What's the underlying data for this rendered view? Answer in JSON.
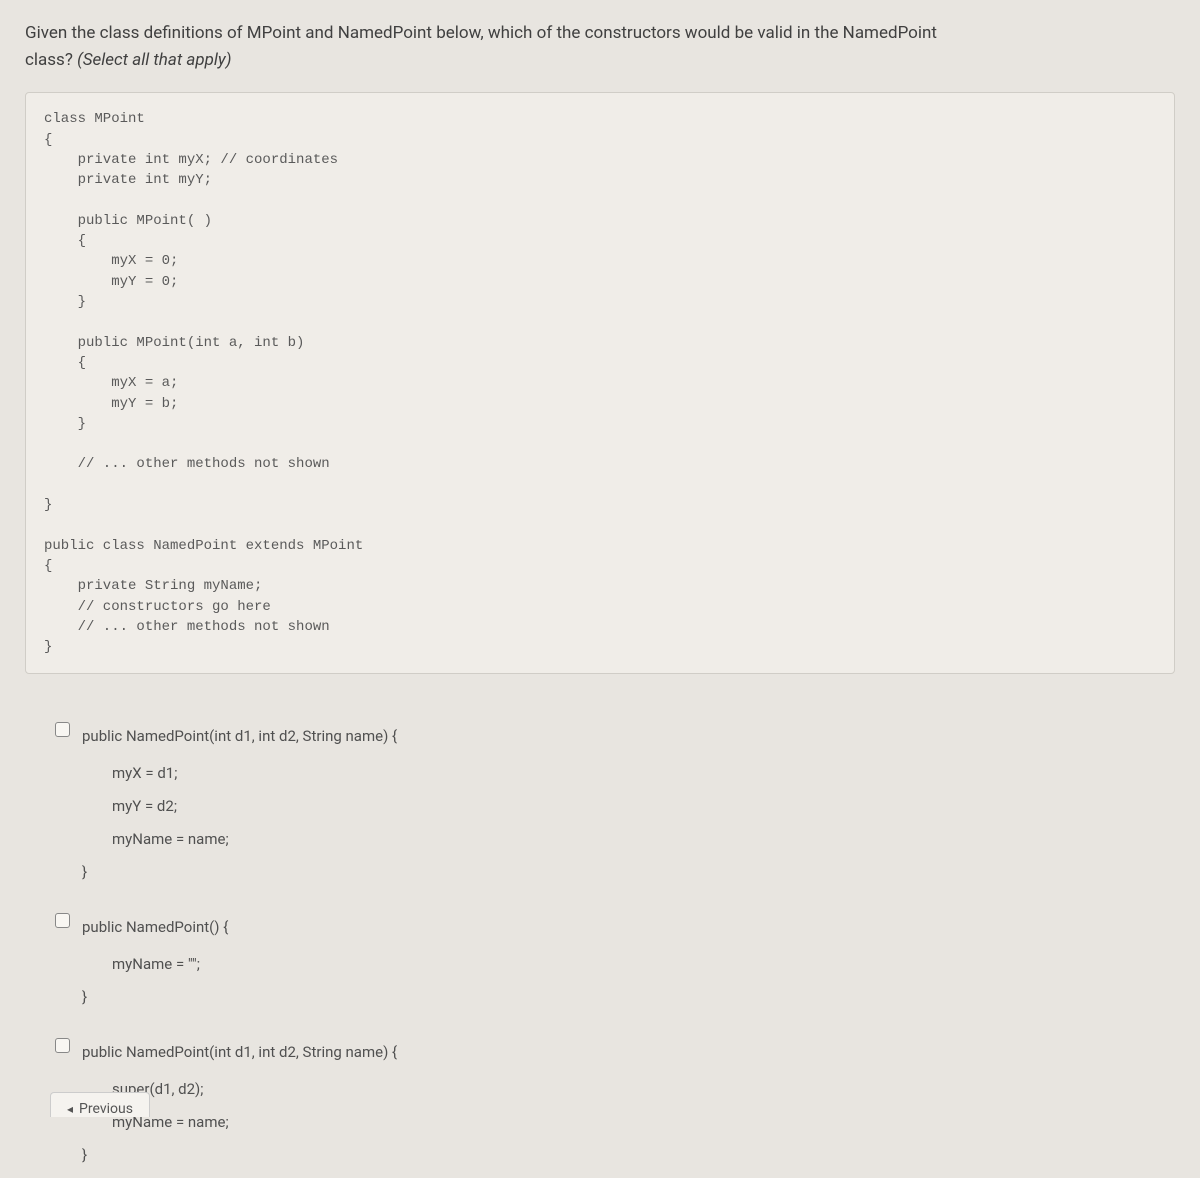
{
  "question": {
    "line1": "Given the class definitions of MPoint and NamedPoint below, which of the constructors would be valid in the NamedPoint",
    "line2_prefix": "class? ",
    "line2_italic": "(Select all that apply)"
  },
  "code": "class MPoint\n{\n    private int myX; // coordinates\n    private int myY;\n\n    public MPoint( )\n    {\n        myX = 0;\n        myY = 0;\n    }\n\n    public MPoint(int a, int b)\n    {\n        myX = a;\n        myY = b;\n    }\n\n    // ... other methods not shown\n\n}\n\npublic class NamedPoint extends MPoint\n{\n    private String myName;\n    // constructors go here\n    // ... other methods not shown\n}",
  "answers": [
    {
      "head": "public NamedPoint(int d1, int d2, String name) {",
      "lines": [
        "myX = d1;",
        "myY = d2;",
        "myName = name;"
      ],
      "close": "}"
    },
    {
      "head": "public NamedPoint() {",
      "lines": [
        "myName = \"\";"
      ],
      "close": "}"
    },
    {
      "head": "public NamedPoint(int d1, int d2, String name) {",
      "lines": [
        "super(d1, d2);",
        "myName = name;"
      ],
      "close": "}"
    }
  ],
  "nav": {
    "previous": "Previous",
    "arrow": "◂"
  }
}
